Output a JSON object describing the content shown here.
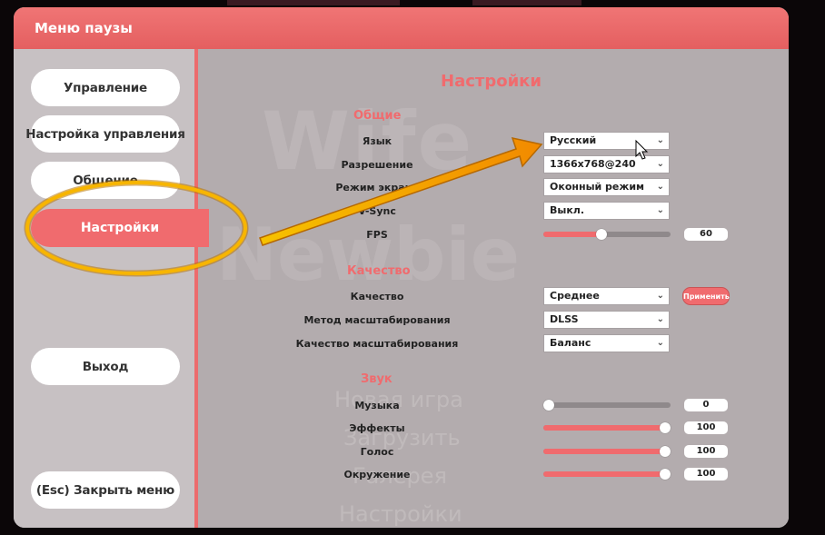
{
  "window": {
    "title": "Меню паузы"
  },
  "sidebar": {
    "items": [
      {
        "label": "Управление"
      },
      {
        "label": "Настройка управления"
      },
      {
        "label": "Общение"
      },
      {
        "label": "Настройки"
      },
      {
        "label": "Выход"
      },
      {
        "label": "(Esc) Закрыть меню"
      }
    ],
    "active_index": 3
  },
  "background_text": {
    "logo_top": "Wife",
    "logo_bottom": "Newbie",
    "menu_items": [
      "Новая игра",
      "Загрузить",
      "Галерея",
      "Настройки"
    ]
  },
  "settings": {
    "title": "Настройки",
    "general": {
      "title": "Общие",
      "language_label": "Язык",
      "language_value": "Русский",
      "resolution_label": "Разрешение",
      "resolution_value": "1366x768@240",
      "screen_mode_label": "Режим экрана",
      "screen_mode_value": "Оконный режим",
      "vsync_label": "V-Sync",
      "vsync_value": "Выкл.",
      "fps_label": "FPS",
      "fps_value": "60",
      "fps_fraction": 0.46
    },
    "quality": {
      "title": "Качество",
      "quality_label": "Качество",
      "quality_value": "Среднее",
      "apply_label": "Применить",
      "scaling_method_label": "Метод масштабирования",
      "scaling_method_value": "DLSS",
      "scaling_quality_label": "Качество масштабирования",
      "scaling_quality_value": "Баланс"
    },
    "sound": {
      "title": "Звук",
      "music_label": "Музыка",
      "music_value": "0",
      "music_fraction": 0.0,
      "effects_label": "Эффекты",
      "effects_value": "100",
      "effects_fraction": 1.0,
      "voice_label": "Голос",
      "voice_value": "100",
      "voice_fraction": 1.0,
      "ambient_label": "Окружение",
      "ambient_value": "100",
      "ambient_fraction": 1.0
    }
  },
  "colors": {
    "accent": "#f06b6e",
    "highlight_ring": "#f7b800",
    "arrow": "#f59a00"
  }
}
